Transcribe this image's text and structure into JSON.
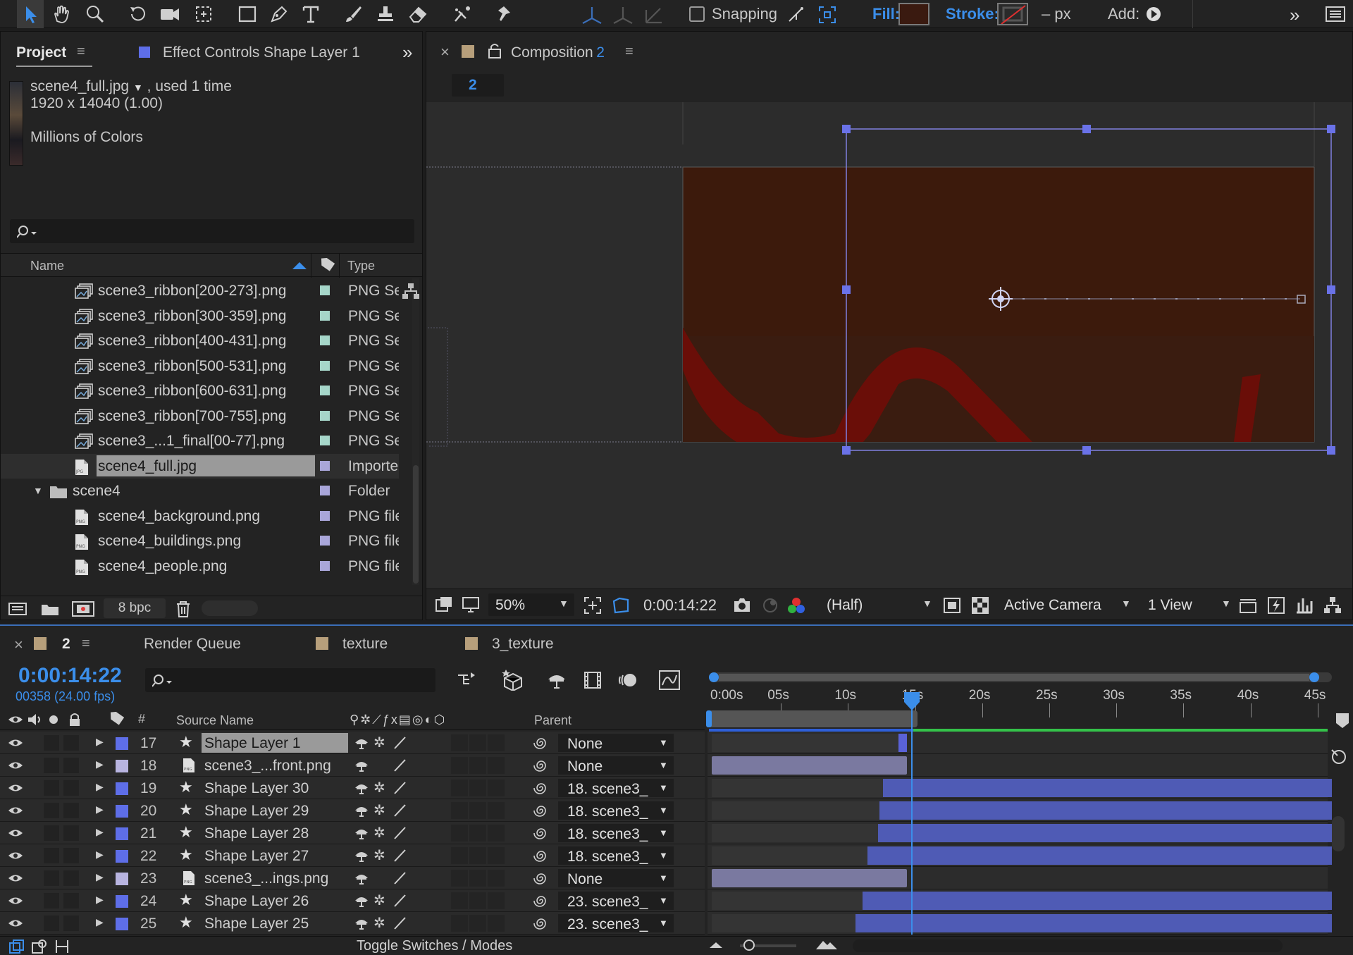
{
  "toolbar": {
    "snapping_label": "Snapping",
    "fill_label": "Fill:",
    "stroke_label": "Stroke:",
    "stroke_width": "– px",
    "add_label": "Add:",
    "fill_color": "#3a1a10",
    "accent": "#3b8eea"
  },
  "project_panel": {
    "tab_project": "Project",
    "tab_effect_controls": "Effect Controls Shape Layer 1",
    "selected_file": "scene4_full.jpg",
    "used_text": ", used 1 time",
    "dimensions": "1920 x 14040 (1.00)",
    "colors": "Millions of Colors",
    "col_name": "Name",
    "col_type": "Type",
    "bpc": "8 bpc",
    "items": [
      {
        "name": "scene3_ribbon[200-273].png",
        "type": "PNG Se",
        "label_color": "#a6d6c9",
        "icon": "sequence-icon",
        "indent": 1
      },
      {
        "name": "scene3_ribbon[300-359].png",
        "type": "PNG Se",
        "label_color": "#a6d6c9",
        "icon": "sequence-icon",
        "indent": 1
      },
      {
        "name": "scene3_ribbon[400-431].png",
        "type": "PNG Se",
        "label_color": "#a6d6c9",
        "icon": "sequence-icon",
        "indent": 1
      },
      {
        "name": "scene3_ribbon[500-531].png",
        "type": "PNG Se",
        "label_color": "#a6d6c9",
        "icon": "sequence-icon",
        "indent": 1
      },
      {
        "name": "scene3_ribbon[600-631].png",
        "type": "PNG Se",
        "label_color": "#a6d6c9",
        "icon": "sequence-icon",
        "indent": 1
      },
      {
        "name": "scene3_ribbon[700-755].png",
        "type": "PNG Se",
        "label_color": "#a6d6c9",
        "icon": "sequence-icon",
        "indent": 1
      },
      {
        "name": "scene3_...1_final[00-77].png",
        "type": "PNG Se",
        "label_color": "#a6d6c9",
        "icon": "sequence-icon",
        "indent": 1
      },
      {
        "name": "scene4_full.jpg",
        "type": "Importe",
        "label_color": "#a9a6d9",
        "icon": "image-file-icon",
        "indent": 1,
        "selected": true
      },
      {
        "name": "scene4",
        "type": "Folder",
        "label_color": "#a9a6d9",
        "icon": "folder-icon",
        "indent": 0,
        "folder": true
      },
      {
        "name": "scene4_background.png",
        "type": "PNG file",
        "label_color": "#a9a6d9",
        "icon": "png-file-icon",
        "indent": 1
      },
      {
        "name": "scene4_buildings.png",
        "type": "PNG file",
        "label_color": "#a9a6d9",
        "icon": "png-file-icon",
        "indent": 1
      },
      {
        "name": "scene4_people.png",
        "type": "PNG file",
        "label_color": "#a9a6d9",
        "icon": "png-file-icon",
        "indent": 1
      }
    ]
  },
  "composition_panel": {
    "tab_label": "Composition",
    "comp_number": "2",
    "breadcrumb": "2",
    "zoom": "50%",
    "timecode": "0:00:14:22",
    "resolution": "(Half)",
    "camera": "Active Camera",
    "views": "1 View"
  },
  "timeline": {
    "tabs": [
      {
        "label": "2",
        "active": true
      },
      {
        "label": "Render Queue"
      },
      {
        "label": "texture"
      },
      {
        "label": "3_texture"
      }
    ],
    "current_time": "0:00:14:22",
    "frame_info": "00358 (24.00 fps)",
    "col_hash": "#",
    "col_source": "Source Name",
    "col_parent": "Parent",
    "toggle_label": "Toggle Switches / Modes",
    "ruler_labels": [
      "0:00s",
      "05s",
      "10s",
      "15s",
      "20s",
      "25s",
      "30s",
      "35s",
      "40s",
      "45s"
    ],
    "layers": [
      {
        "num": "17",
        "name": "Shape Layer 1",
        "type": "shape",
        "label_color": "#5e6ee8",
        "parent": "None",
        "selected": true,
        "bar_start": 0.301,
        "bar_end": 0.315
      },
      {
        "num": "18",
        "name": "scene3_...front.png",
        "type": "footage",
        "label_color": "#b8b4e0",
        "parent": "None",
        "bar_start": 0.0,
        "bar_end": 0.315
      },
      {
        "num": "19",
        "name": "Shape Layer 30",
        "type": "shape",
        "label_color": "#5e6ee8",
        "parent": "18. scene3_",
        "bar_start": 0.276,
        "bar_end": 1.0
      },
      {
        "num": "20",
        "name": "Shape Layer 29",
        "type": "shape",
        "label_color": "#5e6ee8",
        "parent": "18. scene3_",
        "bar_start": 0.27,
        "bar_end": 1.0
      },
      {
        "num": "21",
        "name": "Shape Layer 28",
        "type": "shape",
        "label_color": "#5e6ee8",
        "parent": "18. scene3_",
        "bar_start": 0.268,
        "bar_end": 1.0
      },
      {
        "num": "22",
        "name": "Shape Layer 27",
        "type": "shape",
        "label_color": "#5e6ee8",
        "parent": "18. scene3_",
        "bar_start": 0.251,
        "bar_end": 1.0
      },
      {
        "num": "23",
        "name": "scene3_...ings.png",
        "type": "footage",
        "label_color": "#b8b4e0",
        "parent": "None",
        "bar_start": 0.0,
        "bar_end": 0.315
      },
      {
        "num": "24",
        "name": "Shape Layer 26",
        "type": "shape",
        "label_color": "#5e6ee8",
        "parent": "23. scene3_",
        "bar_start": 0.243,
        "bar_end": 1.0
      },
      {
        "num": "25",
        "name": "Shape Layer 25",
        "type": "shape",
        "label_color": "#5e6ee8",
        "parent": "23. scene3_",
        "bar_start": 0.232,
        "bar_end": 1.0
      }
    ]
  }
}
